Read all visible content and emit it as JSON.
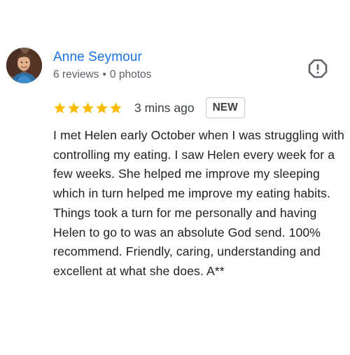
{
  "reviewer": {
    "name": "Anne Seymour",
    "reviews_count": "6 reviews",
    "separator": "•",
    "photos_count": "0 photos"
  },
  "rating": {
    "stars": 5,
    "max_stars": 5,
    "star_color": "#fbbc04",
    "time_ago": "3 mins ago",
    "badge": "NEW"
  },
  "review": {
    "text": "I met Helen early October when I was struggling with controlling my eating. I saw Helen every week for a few weeks. She helped me improve my sleeping which in turn helped me improve my eating habits. Things took a turn for me personally and having Helen to go to was an absolute God send. 100% recommend. Friendly, caring, understanding and excellent at what she does. A**"
  },
  "icons": {
    "avatar": "avatar",
    "report": "report-octagon-icon",
    "star": "star-icon"
  },
  "colors": {
    "name_link": "#1a73e8",
    "meta_text": "#5f6368",
    "body_text": "#202124"
  }
}
